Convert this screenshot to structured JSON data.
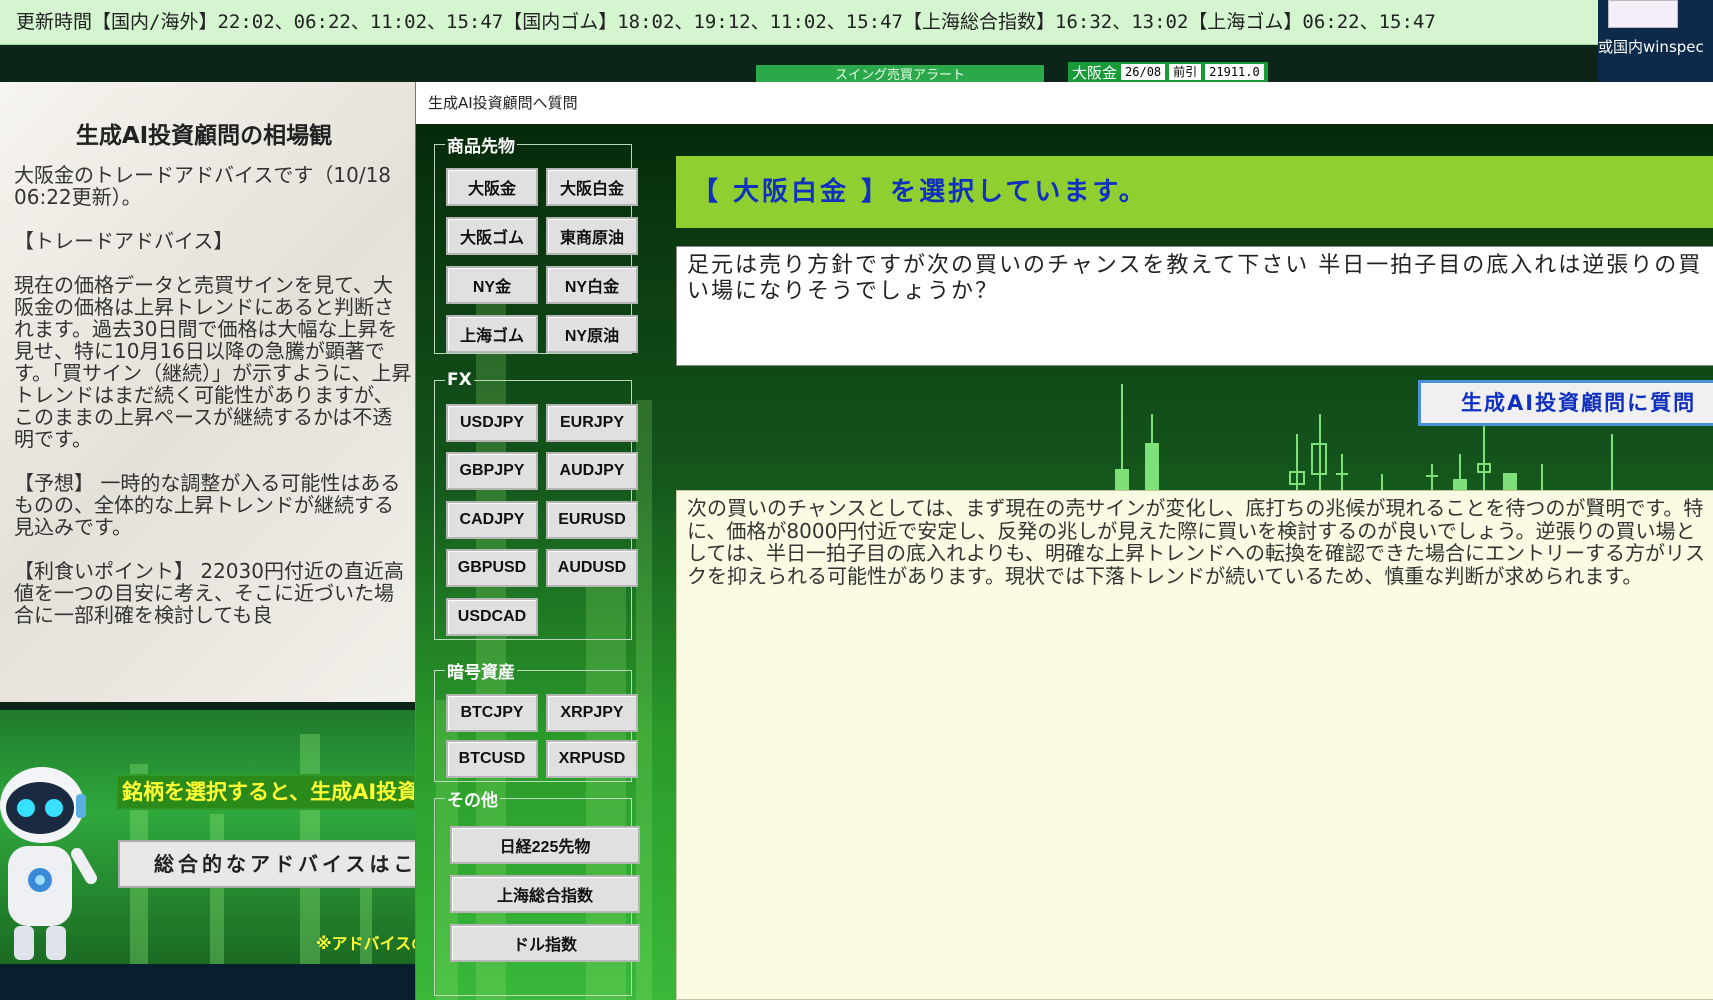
{
  "top_bar": {
    "text": "更新時間【国内/海外】22:02、06:22、11:02、15:47【国内ゴム】18:02、19:12、11:02、15:47【上海総合指数】16:32、13:02【上海ゴム】06:22、15:47"
  },
  "band": {
    "tab_label": "スイング売買アラート",
    "quote": {
      "name": "大阪金",
      "contract": "26/08",
      "type": "前引",
      "price": "21911.0"
    }
  },
  "desktop_icon": {
    "label": "或国内winspec"
  },
  "left_panel": {
    "title": "生成AI投資顧問の相場観",
    "intro": "大阪金のトレードアドバイスです（10/18 06:22更新）。",
    "section_heading": "【トレードアドバイス】",
    "advice": "現在の価格データと売買サインを見て、大阪金の価格は上昇トレンドにあると判断されます。過去30日間で価格は大幅な上昇を見せ、特に10月16日以降の急騰が顕著です。「買サイン（継続）」が示すように、上昇トレンドはまだ続く可能性がありますが、このままの上昇ペースが継続するかは不透明です。",
    "forecast": "【予想】 一時的な調整が入る可能性はあるものの、全体的な上昇トレンドが継続する見込みです。",
    "take_profit": "【利食いポイント】 22030円付近の直近高値を一つの目安に考え、そこに近づいた場合に一部利確を検討しても良",
    "hint": "銘柄を選択すると、生成AI投資顧問からのアドバイスが表示されます。",
    "overall_button": "総合的なアドバイスはこちら",
    "note": "※アドバイスの"
  },
  "dialog": {
    "title": "生成AI投資顧問へ質問",
    "groups": {
      "commodities": {
        "legend": "商品先物",
        "buttons": [
          "大阪金",
          "大阪白金",
          "大阪ゴム",
          "東商原油",
          "NY金",
          "NY白金",
          "上海ゴム",
          "NY原油"
        ]
      },
      "fx": {
        "legend": "FX",
        "buttons": [
          "USDJPY",
          "EURJPY",
          "GBPJPY",
          "AUDJPY",
          "CADJPY",
          "EURUSD",
          "GBPUSD",
          "AUDUSD",
          "USDCAD"
        ]
      },
      "crypto": {
        "legend": "暗号資産",
        "buttons": [
          "BTCJPY",
          "XRPJPY",
          "BTCUSD",
          "XRPUSD"
        ]
      },
      "other": {
        "legend": "その他",
        "buttons": [
          "日経225先物",
          "上海総合指数",
          "ドル指数"
        ]
      }
    },
    "selection_banner": "【 大阪白金 】を選択しています。",
    "question": "足元は売り方針ですが次の買いのチャンスを教えて下さい 半日一拍子目の底入れは逆張りの買い場になりそうでしょうか？",
    "ask_button": "生成AI投資顧問に質問",
    "answer": "次の買いのチャンスとしては、まず現在の売サインが変化し、底打ちの兆候が現れることを待つのが賢明です。特に、価格が8000円付近で安定し、反発の兆しが見えた際に買いを検討するのが良いでしょう。逆張りの買い場としては、半日一拍子目の底入れよりも、明確な上昇トレンドへの転換を確認できた場合にエントリーする方がリスクを抑えられる可能性があります。現状では下落トレンドが続いているため、慎重な判断が求められます。"
  },
  "colors": {
    "accent_green": "#8fd030",
    "banner_text": "#1030c0",
    "hint_yellow": "#ffff33",
    "answer_bg": "#fbfbe4",
    "top_bar_bg": "#d4f5d0"
  }
}
